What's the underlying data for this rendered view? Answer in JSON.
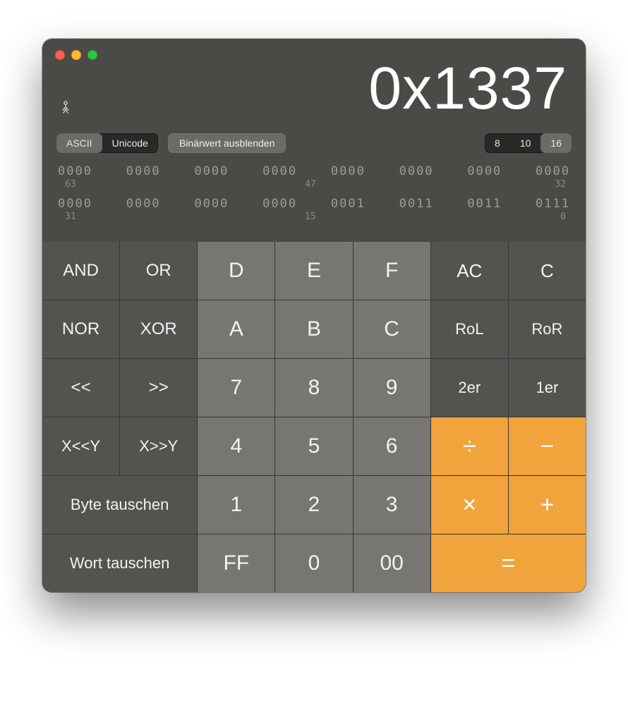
{
  "display": {
    "value": "0x1337"
  },
  "controls": {
    "encoding": {
      "ascii": "ASCII",
      "unicode": "Unicode",
      "active": "ascii"
    },
    "hide_binary": "Binärwert ausblenden",
    "base": {
      "b8": "8",
      "b10": "10",
      "b16": "16",
      "active": "b16"
    }
  },
  "binary": {
    "row1": {
      "bits": [
        "0000",
        "0000",
        "0000",
        "0000",
        "0000",
        "0000",
        "0000",
        "0000"
      ],
      "left": "63",
      "mid": "47",
      "right": "32"
    },
    "row2": {
      "bits": [
        "0000",
        "0000",
        "0000",
        "0000",
        "0001",
        "0011",
        "0011",
        "0111"
      ],
      "left": "31",
      "mid": "15",
      "right": "0"
    }
  },
  "keys": {
    "and": "AND",
    "or": "OR",
    "d": "D",
    "e": "E",
    "f": "F",
    "ac": "AC",
    "c": "C",
    "nor": "NOR",
    "xor": "XOR",
    "a": "A",
    "b": "B",
    "cHex": "C",
    "rol": "RoL",
    "ror": "RoR",
    "shl": "<<",
    "shr": ">>",
    "k7": "7",
    "k8": "8",
    "k9": "9",
    "twos": "2er",
    "ones": "1er",
    "xsl": "X<<Y",
    "xsr": "X>>Y",
    "k4": "4",
    "k5": "5",
    "k6": "6",
    "div": "÷",
    "sub": "−",
    "byteflip": "Byte tauschen",
    "k1": "1",
    "k2": "2",
    "k3": "3",
    "mul": "×",
    "add": "+",
    "wordflip": "Wort tauschen",
    "ff": "FF",
    "k0": "0",
    "zz": "00",
    "eq": "="
  }
}
